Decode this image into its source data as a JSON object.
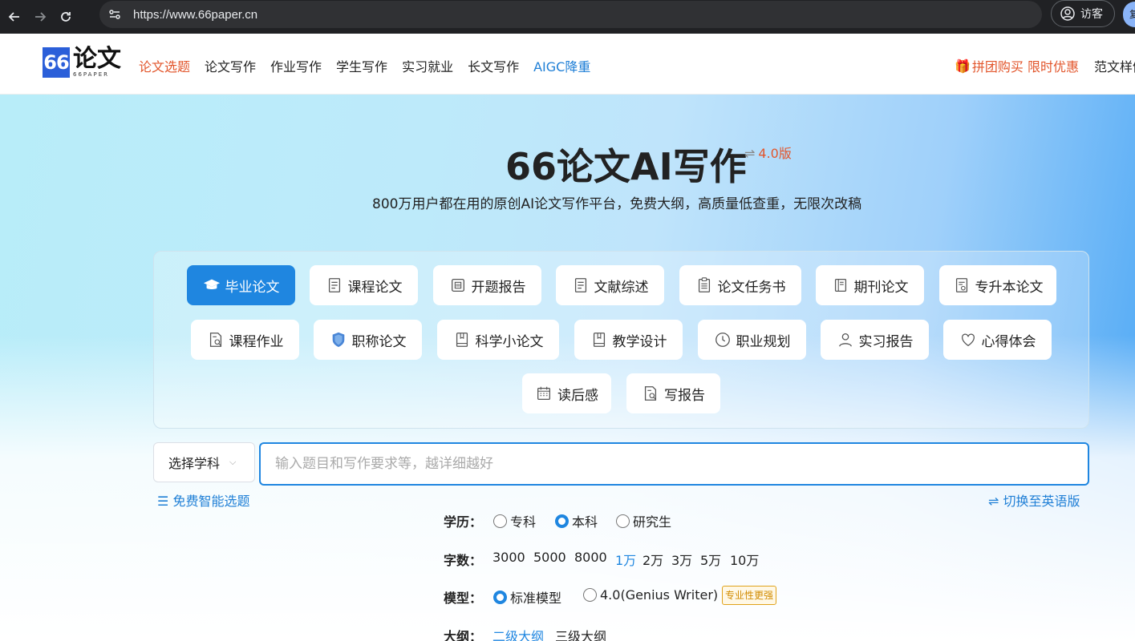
{
  "browser": {
    "url": "https://www.66paper.cn",
    "visitor_label": "访客",
    "edge_label": "复"
  },
  "header": {
    "logo_mark": "66",
    "logo_cn": "论文",
    "logo_en": "66PAPER",
    "nav": [
      "论文选题",
      "论文写作",
      "作业写作",
      "学生写作",
      "实习就业",
      "长文写作",
      "AIGC降重"
    ],
    "promo": "拼团购买 限时优惠",
    "sample": "范文样例"
  },
  "hero": {
    "title": "66论文AI写作",
    "version": "4.0版",
    "subtitle": "800万用户都在用的原创AI论文写作平台，免费大纲，高质量低查重，无限次改稿"
  },
  "categories": [
    {
      "label": "毕业论文",
      "icon": "graduation-cap-icon"
    },
    {
      "label": "课程论文",
      "icon": "document-icon"
    },
    {
      "label": "开题报告",
      "icon": "report-icon"
    },
    {
      "label": "文献综述",
      "icon": "document-icon"
    },
    {
      "label": "论文任务书",
      "icon": "clipboard-icon"
    },
    {
      "label": "期刊论文",
      "icon": "journal-icon"
    },
    {
      "label": "专升本论文",
      "icon": "certificate-icon"
    },
    {
      "label": "课程作业",
      "icon": "document-search-icon"
    },
    {
      "label": "职称论文",
      "icon": "shield-icon"
    },
    {
      "label": "科学小论文",
      "icon": "book-icon"
    },
    {
      "label": "教学设计",
      "icon": "book-icon"
    },
    {
      "label": "职业规划",
      "icon": "clock-icon"
    },
    {
      "label": "实习报告",
      "icon": "person-icon"
    },
    {
      "label": "心得体会",
      "icon": "heart-icon"
    },
    {
      "label": "读后感",
      "icon": "calendar-icon"
    },
    {
      "label": "写报告",
      "icon": "document-search-icon"
    }
  ],
  "form": {
    "subject_select": "选择学科",
    "topic_placeholder": "输入题目和写作要求等，越详细越好",
    "free_topic": "免费智能选题",
    "switch_english": "切换至英语版",
    "education_label": "学历：",
    "education_options": [
      "专科",
      "本科",
      "研究生"
    ],
    "education_selected": "本科",
    "words_label": "字数：",
    "words_options": [
      "3000",
      "5000",
      "8000",
      "1万",
      "2万",
      "3万",
      "5万",
      "10万"
    ],
    "words_selected": "1万",
    "model_label": "模型：",
    "model_options": [
      "标准模型",
      "4.0(Genius Writer)"
    ],
    "model_selected": "标准模型",
    "model_badge": "专业性更强",
    "outline_label": "大纲：",
    "outline_options": [
      "二级大纲",
      "三级大纲"
    ],
    "outline_selected": "二级大纲"
  },
  "colors": {
    "accent": "#1f86e0",
    "promo": "#e2562c"
  }
}
